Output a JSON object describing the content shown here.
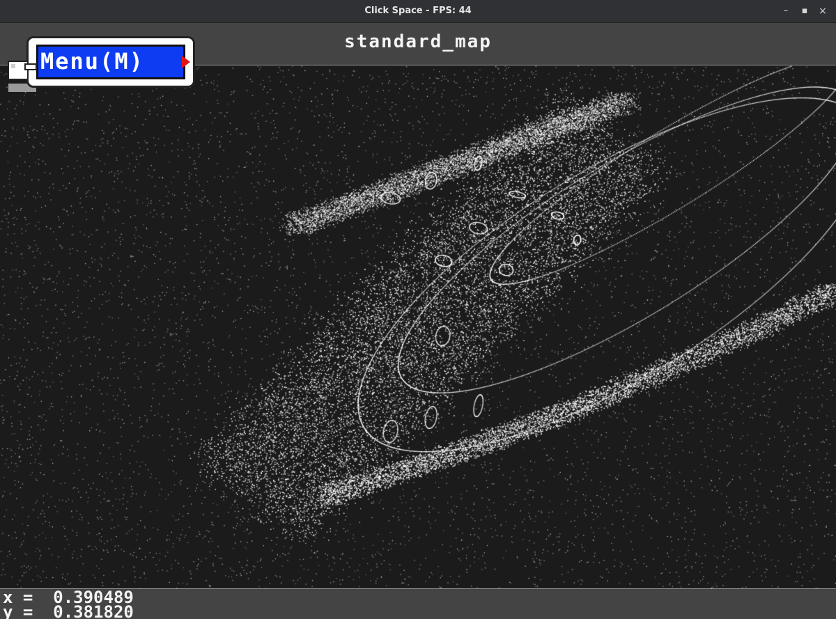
{
  "window": {
    "title": "Click Space - FPS: 44",
    "min_icon": "minimize-icon",
    "max_icon": "maximize-icon",
    "close_icon": "close-icon"
  },
  "header": {
    "scene_title": "standard_map",
    "menu_label": "Menu(M)"
  },
  "readout": {
    "x_label": "x =  0.390489",
    "y_label": "y =  0.381820"
  },
  "colors": {
    "background": "#1b1b1b",
    "bar": "#444444",
    "points": "#ffffff",
    "menu_blue": "#0d3cf2",
    "menu_arrow": "#e01515"
  }
}
